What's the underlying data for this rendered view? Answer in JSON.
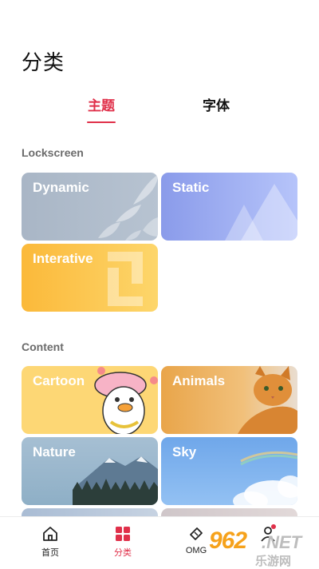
{
  "page": {
    "title": "分类"
  },
  "tabs": [
    {
      "label": "主题",
      "active": true
    },
    {
      "label": "字体",
      "active": false
    }
  ],
  "sections": {
    "lockscreen": {
      "title": "Lockscreen",
      "cards": [
        {
          "label": "Dynamic"
        },
        {
          "label": "Static"
        },
        {
          "label": "Interative"
        }
      ]
    },
    "content": {
      "title": "Content",
      "cards": [
        {
          "label": "Cartoon"
        },
        {
          "label": "Animals"
        },
        {
          "label": "Nature"
        },
        {
          "label": "Sky"
        }
      ]
    }
  },
  "bottom_nav": [
    {
      "label": "首页",
      "icon": "home-icon"
    },
    {
      "label": "分类",
      "icon": "grid-icon",
      "active": true
    },
    {
      "label": "OMG",
      "icon": "ticket-icon"
    },
    {
      "label": "",
      "icon": "profile-icon"
    }
  ],
  "watermark": {
    "main": "962",
    "net": ".NET",
    "sub": "乐游网"
  },
  "colors": {
    "accent": "#e0304a",
    "section_label": "#6b6b6b"
  }
}
